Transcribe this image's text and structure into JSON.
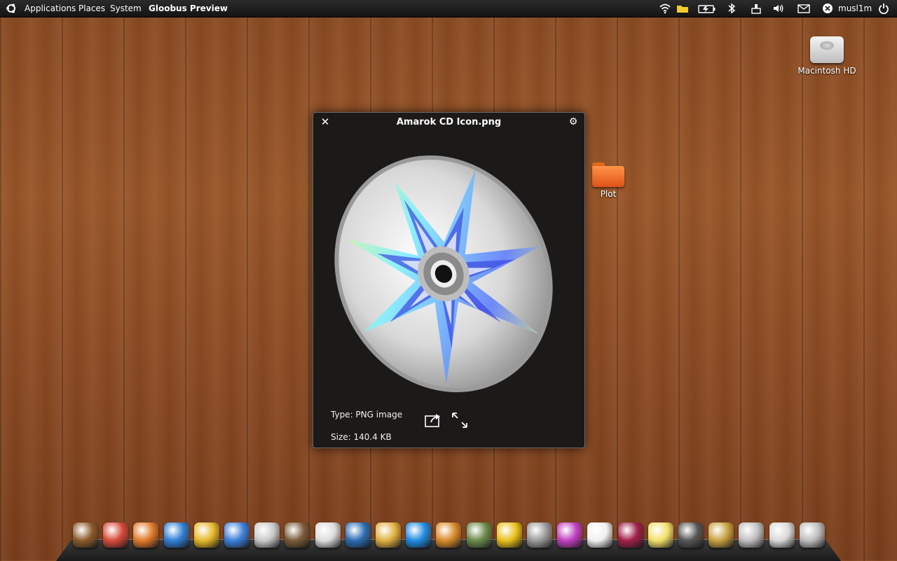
{
  "top_panel": {
    "menus": [
      "Applications",
      "Places",
      "System"
    ],
    "active_app": "Gloobus Preview",
    "username": "musl1m",
    "tray_icons": [
      "wifi-icon",
      "folder-icon",
      "battery-icon",
      "bluetooth-icon",
      "network-icon",
      "volume-icon",
      "mail-icon",
      "user-status-icon",
      "power-icon"
    ]
  },
  "desktop": {
    "icons": [
      {
        "label": "Macintosh HD",
        "icon": "hard-drive-icon"
      },
      {
        "label": "Plot",
        "icon": "folder-icon"
      }
    ]
  },
  "preview_window": {
    "title": "Amarok CD Icon.png",
    "type_text": "Type: PNG image",
    "size_text": "Size: 140.4 KB",
    "preview_icon": "cd-disc-image"
  },
  "dock": {
    "items": [
      "bookshelf-icon",
      "origami-crane-icon",
      "firefox-icon",
      "safari-icon",
      "chrome-icon",
      "adium-icon",
      "dvd-player-icon",
      "photo-viewer-icon",
      "mixer-icon",
      "ink-writer-icon",
      "popcorn-icon",
      "refresh-icon",
      "image-editor-icon",
      "picture-frame-icon",
      "headphones-icon",
      "network-tool-icon",
      "color-wheel-icon",
      "coffee-cup-icon",
      "address-book-icon",
      "sticky-notes-icon",
      "display-icon",
      "padlock-icon",
      "system-tools-icon",
      "compass-icon",
      "trash-icon"
    ],
    "colors": [
      "#8a5a2b",
      "#d64a3a",
      "#e07a2a",
      "#2f7fd6",
      "#e5b82a",
      "#3a7fd8",
      "#c9c9c9",
      "#7a5a3a",
      "#dcdcdc",
      "#2a6db3",
      "#e0b040",
      "#1f8be0",
      "#d88a2a",
      "#6a8a4a",
      "#e8c01a",
      "#9a9a9a",
      "#c040c0",
      "#f0f0f0",
      "#a0204a",
      "#f2e06a",
      "#555555",
      "#c8a040",
      "#bfbfbf",
      "#d8d8d8",
      "#bdbdbd"
    ]
  }
}
